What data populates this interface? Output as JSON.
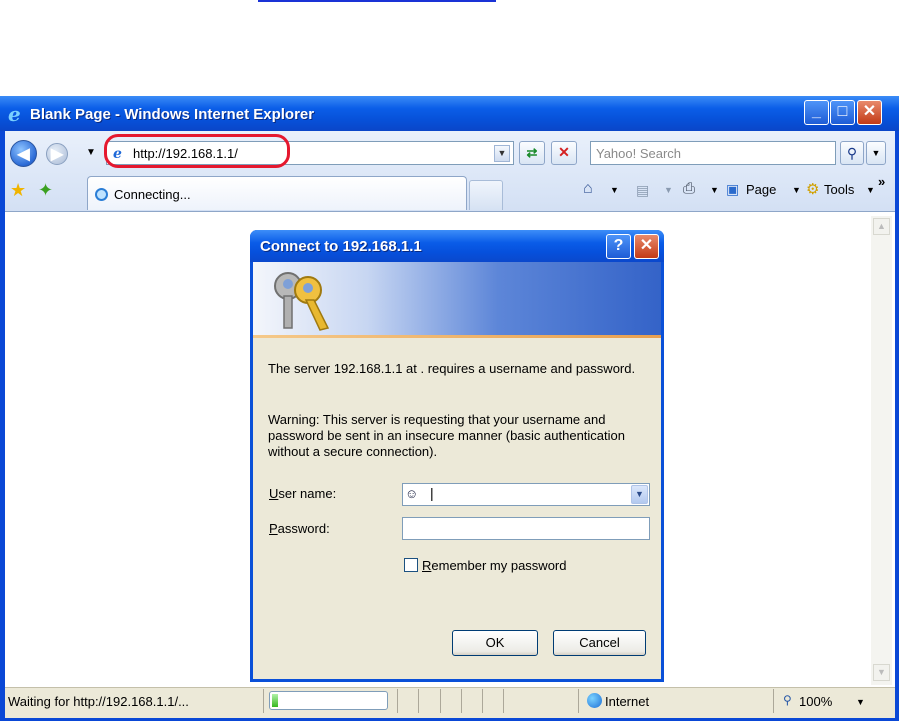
{
  "window": {
    "title": "Blank Page - Windows Internet Explorer",
    "minimize_glyph": "_",
    "maximize_glyph": "□",
    "close_glyph": "✕"
  },
  "toolbar": {
    "address": "http://192.168.1.1/",
    "search_placeholder": "Yahoo! Search",
    "tab_label": "Connecting...",
    "page_label": "Page",
    "tools_label": "Tools",
    "chevron": "»"
  },
  "status": {
    "text": "Waiting for http://192.168.1.1/...",
    "progress_fraction": 0.05,
    "zone": "Internet",
    "zoom": "100%"
  },
  "dialog": {
    "title": "Connect to 192.168.1.1",
    "help_glyph": "?",
    "close_glyph": "✕",
    "message": "The server 192.168.1.1 at . requires a username and password.",
    "warning": "Warning: This server is requesting that your username and password be sent in an insecure manner (basic authentication without a secure connection).",
    "username_label_first": "U",
    "username_label_rest": "ser name:",
    "password_label_first": "P",
    "password_label_rest": "assword:",
    "username_value": "|",
    "password_value": "",
    "remember_label_first": "R",
    "remember_label_rest": "emember my password",
    "remember_checked": false,
    "ok_label": "OK",
    "cancel_label": "Cancel"
  },
  "colors": {
    "titlebar_blue": "#0a5ce8",
    "close_red": "#c33a16",
    "highlight_red": "#e5182f",
    "link_blue": "#1a33d6"
  }
}
